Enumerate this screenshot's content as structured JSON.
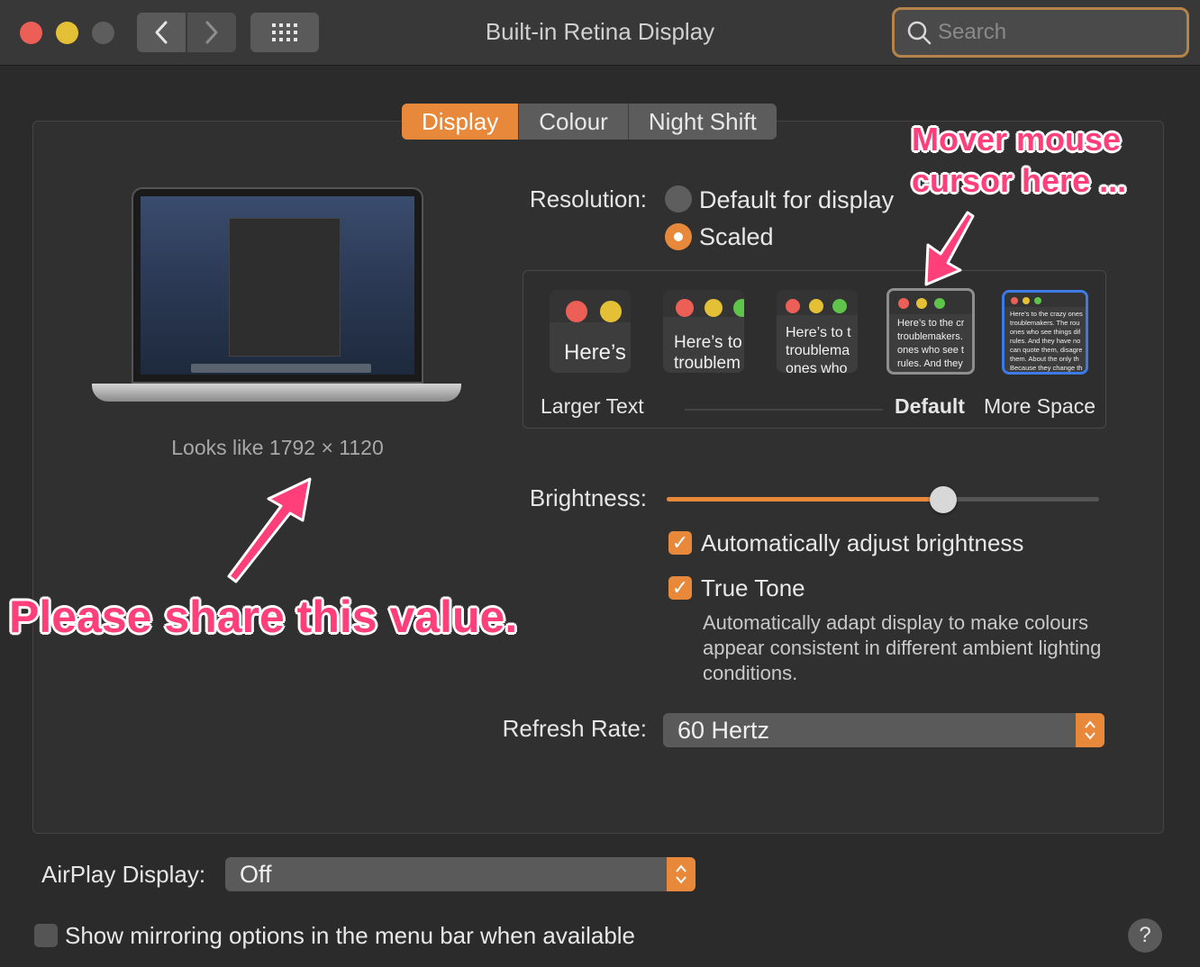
{
  "window": {
    "title": "Built-in Retina Display",
    "search_placeholder": "Search"
  },
  "tabs": [
    {
      "label": "Display",
      "active": true
    },
    {
      "label": "Colour",
      "active": false
    },
    {
      "label": "Night Shift",
      "active": false
    }
  ],
  "display": {
    "looks_like": "Looks like 1792 × 1120",
    "resolution_label": "Resolution:",
    "resolution_options": [
      {
        "label": "Default for display",
        "selected": false
      },
      {
        "label": "Scaled",
        "selected": true
      }
    ],
    "thumbnails": [
      {
        "text": "Here’s"
      },
      {
        "text1": "Here’s to",
        "text2": "troublem"
      },
      {
        "text1": "Here’s to t",
        "text2": "troublema",
        "text3": "ones who"
      },
      {
        "text1": "Here’s to the cr",
        "text2": "troublemakers.",
        "text3": "ones who see t",
        "text4": "rules. And they"
      },
      {
        "lines": [
          "Here’s to the crazy ones",
          "troublemakers. The rou",
          "ones who see things dif",
          "rules. And they have no",
          "can quote them, disagre",
          "them. About the only th",
          "Because they change th"
        ]
      }
    ],
    "scale_labels": {
      "larger": "Larger Text",
      "default": "Default",
      "more": "More Space"
    },
    "brightness_label": "Brightness:",
    "brightness_value": 0.64,
    "auto_brightness": {
      "label": "Automatically adjust brightness",
      "checked": true
    },
    "true_tone": {
      "label": "True Tone",
      "checked": true,
      "description": "Automatically adapt display to make colours appear consistent in different ambient lighting conditions."
    },
    "refresh_label": "Refresh Rate:",
    "refresh_value": "60 Hertz"
  },
  "airplay": {
    "label": "AirPlay Display:",
    "value": "Off"
  },
  "mirroring": {
    "label": "Show mirroring options in the menu bar when available",
    "checked": false
  },
  "help_label": "?",
  "annotations": {
    "cursor_note_line1": "Mover mouse",
    "cursor_note_line2": "cursor here ...",
    "share_note": "Please share this value."
  },
  "colors": {
    "accent": "#e8883a",
    "annotation": "#ff3f7a"
  }
}
